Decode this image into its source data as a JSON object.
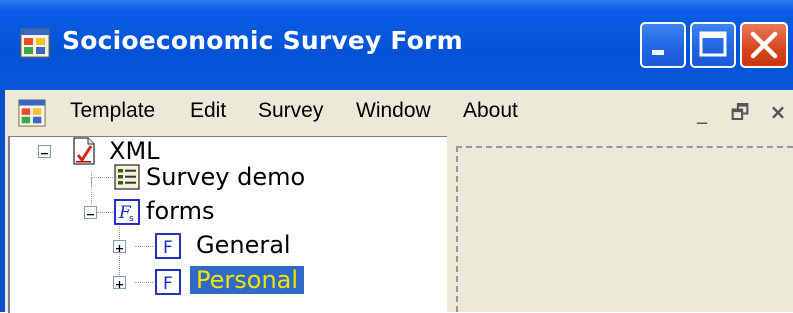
{
  "window": {
    "title": "Socioeconomic Survey Form",
    "icon": "app-form-icon",
    "controls": [
      "minimize-icon",
      "maximize-icon",
      "close-icon"
    ]
  },
  "menubar": {
    "icon": "mdi-child-form-icon",
    "items": [
      "Template",
      "Edit",
      "Survey",
      "Window",
      "About"
    ],
    "mdi_controls": {
      "minimize": "_",
      "restore": "🗗",
      "close": "×"
    }
  },
  "tree": {
    "root": {
      "label": "XML",
      "expander": "−",
      "icon": "xml-document-icon"
    },
    "nodes": [
      {
        "label": "Survey demo",
        "icon": "survey-list-icon"
      },
      {
        "label": "forms",
        "expander": "−",
        "icon": "forms-folder-icon"
      },
      {
        "label": "General",
        "expander": "+",
        "icon": "form-F-icon"
      },
      {
        "label": "Personal",
        "expander": "+",
        "icon": "form-F-icon",
        "selected": true
      }
    ],
    "icon_letter": "F"
  },
  "colors": {
    "title_bar": "#0452d6",
    "selection_bg": "#316ac5",
    "selection_text": "#f4e500",
    "chrome": "#ece9d8"
  }
}
